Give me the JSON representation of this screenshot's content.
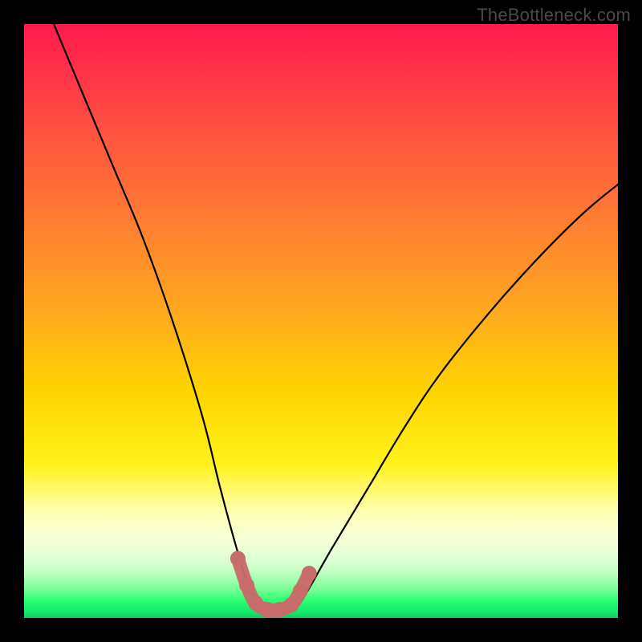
{
  "watermark": "TheBottleneck.com",
  "chart_data": {
    "type": "line",
    "title": "",
    "xlabel": "",
    "ylabel": "",
    "xlim": [
      0,
      100
    ],
    "ylim": [
      0,
      100
    ],
    "series": [
      {
        "name": "bottleneck-curve",
        "x": [
          5,
          10,
          15,
          20,
          25,
          30,
          33,
          36,
          38,
          40,
          42,
          44,
          46,
          48,
          52,
          58,
          64,
          70,
          78,
          86,
          94,
          100
        ],
        "y": [
          100,
          88,
          76,
          64,
          50,
          34,
          22,
          11,
          5,
          2,
          1,
          1,
          2,
          5,
          12,
          22,
          32,
          41,
          51,
          60,
          68,
          73
        ]
      }
    ],
    "markers": {
      "name": "trough-markers",
      "color": "#c86b6b",
      "points": [
        {
          "x": 36.0,
          "y": 10.0
        },
        {
          "x": 37.5,
          "y": 5.5
        },
        {
          "x": 39.0,
          "y": 2.5
        },
        {
          "x": 41.0,
          "y": 1.4
        },
        {
          "x": 43.0,
          "y": 1.4
        },
        {
          "x": 45.0,
          "y": 2.2
        },
        {
          "x": 46.5,
          "y": 4.5
        },
        {
          "x": 48.0,
          "y": 7.5
        }
      ]
    },
    "gradient_stops": [
      {
        "pos": 0,
        "color": "#ff1a4d"
      },
      {
        "pos": 50,
        "color": "#ffd400"
      },
      {
        "pos": 88,
        "color": "#ffffc0"
      },
      {
        "pos": 100,
        "color": "#16c960"
      }
    ]
  }
}
